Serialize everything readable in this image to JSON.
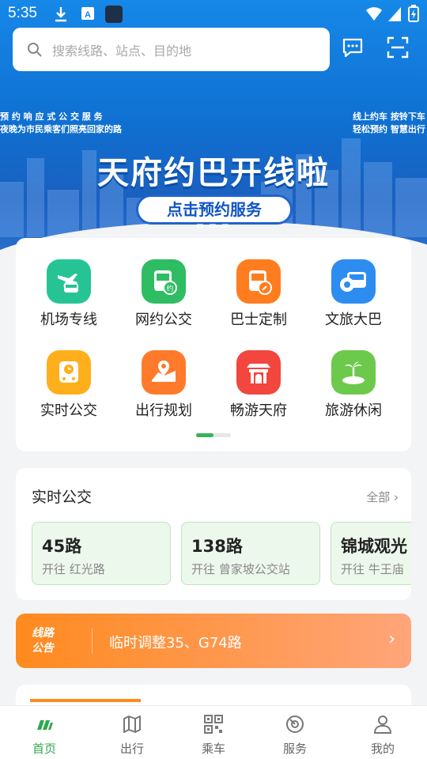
{
  "status_bar": {
    "time": "5:35"
  },
  "search": {
    "placeholder": "搜索线路、站点、目的地"
  },
  "banner": {
    "left_lines": [
      "预 约 响 应 式 公 交 服 务",
      "夜晚为市民乘客们照亮回家的路"
    ],
    "right_lines": [
      "线上约车 按铃下车",
      "轻松预约 智慧出行"
    ],
    "title": "天府约巴开线啦",
    "button": "点击预约服务"
  },
  "functions": [
    {
      "label": "机场专线",
      "icon": "plane-bus-icon",
      "color": "#26c495"
    },
    {
      "label": "网约公交",
      "icon": "bus-booking-icon",
      "color": "#2ebd63"
    },
    {
      "label": "巴士定制",
      "icon": "custom-bus-icon",
      "color": "#ff7d1f"
    },
    {
      "label": "文旅大巴",
      "icon": "tour-bus-icon",
      "color": "#2d8cf0"
    },
    {
      "label": "实时公交",
      "icon": "realtime-bus-icon",
      "color": "#ffaf1c"
    },
    {
      "label": "出行规划",
      "icon": "route-plan-icon",
      "color": "#ff7a2a"
    },
    {
      "label": "畅游天府",
      "icon": "pavilion-icon",
      "color": "#f2463f"
    },
    {
      "label": "旅游休闲",
      "icon": "island-icon",
      "color": "#6dc94b"
    }
  ],
  "realtime": {
    "title": "实时公交",
    "more": "全部",
    "routes": [
      {
        "name": "45路",
        "direction": "开往 红光路"
      },
      {
        "name": "138路",
        "direction": "开往 曾家坡公交站"
      },
      {
        "name": "锦城观光",
        "direction": "开往 牛王庙"
      }
    ]
  },
  "notice": {
    "tag": "线路公告",
    "text": "临时调整35、G74路"
  },
  "tabs": [
    {
      "label": "首页",
      "icon": "home-icon",
      "active": true
    },
    {
      "label": "出行",
      "icon": "map-icon",
      "active": false
    },
    {
      "label": "乘车",
      "icon": "qr-code-icon",
      "active": false
    },
    {
      "label": "服务",
      "icon": "service-icon",
      "active": false
    },
    {
      "label": "我的",
      "icon": "profile-icon",
      "active": false
    }
  ],
  "colors": {
    "accent": "#2fa84f",
    "banner": "#0f6fd0",
    "notice": "#ff8a1e"
  }
}
